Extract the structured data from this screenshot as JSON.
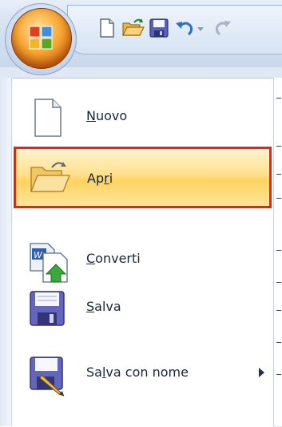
{
  "menu": {
    "items": [
      {
        "label_pre": "",
        "label_ul": "N",
        "label_post": "uovo"
      },
      {
        "label_pre": "Ap",
        "label_ul": "r",
        "label_post": "i"
      },
      {
        "label_pre": "",
        "label_ul": "C",
        "label_post": "onverti"
      },
      {
        "label_pre": "",
        "label_ul": "S",
        "label_post": "alva"
      },
      {
        "label_pre": "Sa",
        "label_ul": "l",
        "label_post": "va con nome"
      }
    ]
  },
  "icons": {
    "office_button": "office-button-icon",
    "new": "blank-document-icon",
    "open": "open-folder-icon",
    "convert": "word-convert-icon",
    "save": "floppy-disk-icon",
    "save_as": "floppy-pencil-icon"
  },
  "colors": {
    "selection_top": "#fff3cf",
    "selection_mid": "#ffd260",
    "annotation_red": "#e3231f"
  }
}
